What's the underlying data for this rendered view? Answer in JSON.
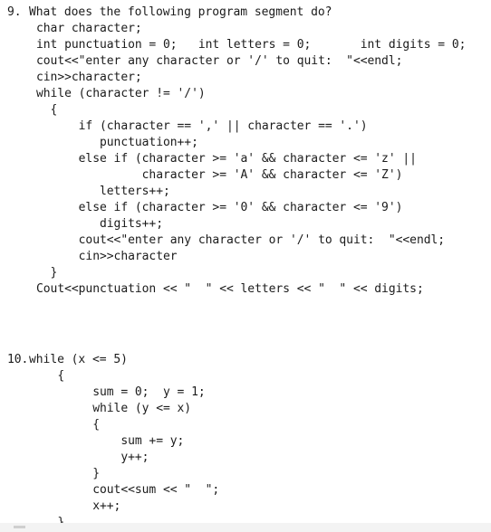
{
  "document": {
    "background_color": "#ffffff",
    "text_color": "#1b1b1b"
  },
  "questions": [
    {
      "number": "9.",
      "prompt": "What does the following program segment do?",
      "code_lines": [
        "char character;",
        "int punctuation = 0;   int letters = 0;       int digits = 0;",
        "cout<<\"enter any character or '/' to quit:  \"<<endl;",
        "cin>>character;",
        "while (character != '/')",
        "  {",
        "      if (character == ',' || character == '.')",
        "         punctuation++;",
        "      else if (character >= 'a' && character <= 'z' ||",
        "               character >= 'A' && character <= 'Z')",
        "         letters++;",
        "      else if (character >= '0' && character <= '9')",
        "         digits++;",
        "      cout<<\"enter any character or '/' to quit:  \"<<endl;",
        "      cin>>character",
        "  }",
        "Cout<<punctuation << \"  \" << letters << \"  \" << digits;"
      ]
    },
    {
      "number": "10.",
      "prompt": "while (x <= 5)",
      "code_lines": [
        "   {",
        "        sum = 0;  y = 1;",
        "        while (y <= x)",
        "        {",
        "            sum += y;",
        "            y++;",
        "        }",
        "        cout<<sum << \"  \";",
        "        x++;",
        "   }"
      ]
    }
  ],
  "footer": {
    "band_color": "#f3f3f3",
    "mark_color": "#cfcfcf"
  }
}
